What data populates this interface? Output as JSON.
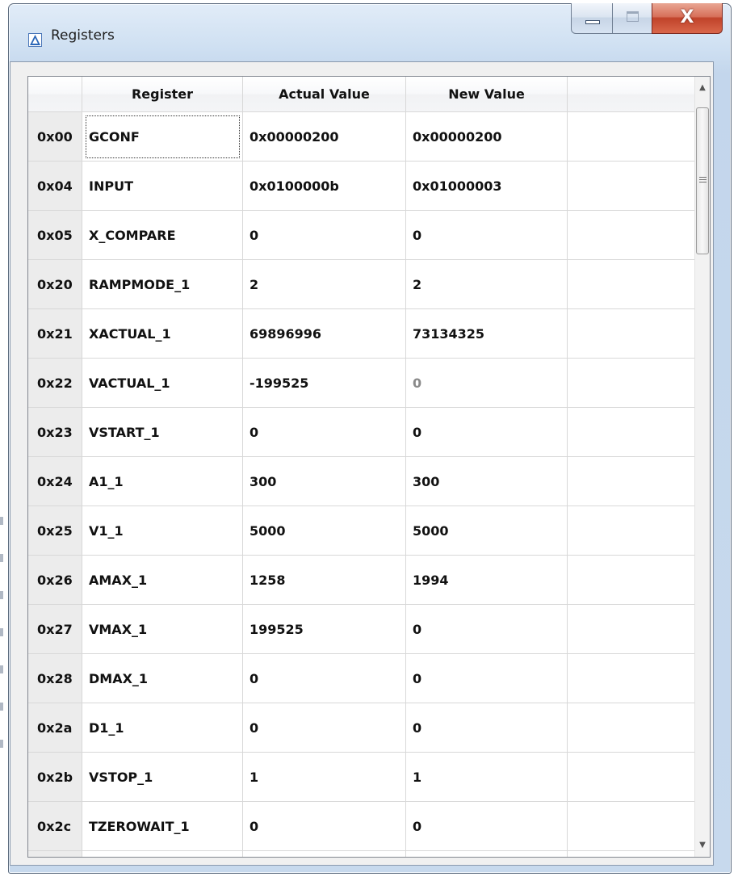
{
  "window": {
    "title": "Registers",
    "controls": {
      "close_label": "X"
    }
  },
  "table": {
    "headers": [
      "",
      "Register",
      "Actual Value",
      "New Value",
      ""
    ],
    "rows": [
      {
        "addr": "0x00",
        "register": "GCONF",
        "actual": "0x00000200",
        "new": "0x00000200"
      },
      {
        "addr": "0x04",
        "register": "INPUT",
        "actual": "0x0100000b",
        "new": "0x01000003"
      },
      {
        "addr": "0x05",
        "register": "X_COMPARE",
        "actual": "0",
        "new": "0"
      },
      {
        "addr": "0x20",
        "register": "RAMPMODE_1",
        "actual": "2",
        "new": "2"
      },
      {
        "addr": "0x21",
        "register": "XACTUAL_1",
        "actual": "69896996",
        "new": "73134325"
      },
      {
        "addr": "0x22",
        "register": "VACTUAL_1",
        "actual": "-199525",
        "new": "0"
      },
      {
        "addr": "0x23",
        "register": "VSTART_1",
        "actual": "0",
        "new": "0"
      },
      {
        "addr": "0x24",
        "register": "A1_1",
        "actual": "300",
        "new": "300"
      },
      {
        "addr": "0x25",
        "register": "V1_1",
        "actual": "5000",
        "new": "5000"
      },
      {
        "addr": "0x26",
        "register": "AMAX_1",
        "actual": "1258",
        "new": "1994"
      },
      {
        "addr": "0x27",
        "register": "VMAX_1",
        "actual": "199525",
        "new": "0"
      },
      {
        "addr": "0x28",
        "register": "DMAX_1",
        "actual": "0",
        "new": "0"
      },
      {
        "addr": "0x2a",
        "register": "D1_1",
        "actual": "0",
        "new": "0"
      },
      {
        "addr": "0x2b",
        "register": "VSTOP_1",
        "actual": "1",
        "new": "1"
      },
      {
        "addr": "0x2c",
        "register": "TZEROWAIT_1",
        "actual": "0",
        "new": "0"
      },
      {
        "addr": "",
        "register": "",
        "actual": "",
        "new": ""
      }
    ],
    "focused_row": 0,
    "dimmed_new_value_row": 5
  },
  "scrollbar": {
    "up_icon": "scroll-up-arrow-icon",
    "down_icon": "scroll-down-arrow-icon",
    "up_glyph": "▲",
    "down_glyph": "▼",
    "position_fraction": 0.0
  },
  "colors": {
    "accent_frame": "#5d6c7f",
    "close_red": "#c0432a",
    "text": "#111111",
    "dimmed_text": "#8a8a8a"
  }
}
